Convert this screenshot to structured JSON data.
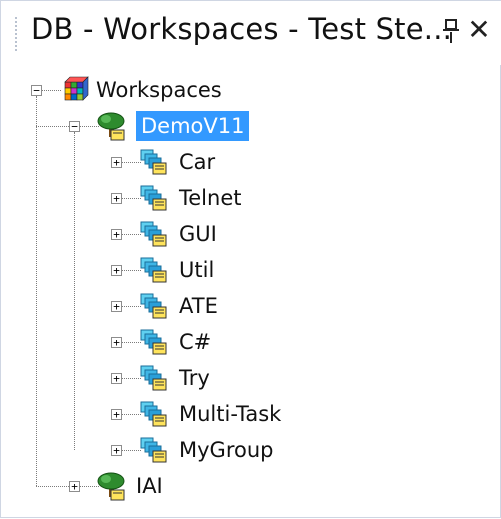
{
  "window": {
    "title": "DB - Workspaces - Test Ste...",
    "pin_icon": "pin-icon",
    "close_icon": "close-icon"
  },
  "tree": {
    "root": {
      "label": "Workspaces",
      "icon": "workspaces-cube-icon",
      "expanded": true
    },
    "workspaces": [
      {
        "label": "DemoV11",
        "icon": "tree-folder-icon",
        "expanded": true,
        "selected": true,
        "children": [
          {
            "label": "Car",
            "icon": "group-icon"
          },
          {
            "label": "Telnet",
            "icon": "group-icon"
          },
          {
            "label": "GUI",
            "icon": "group-icon"
          },
          {
            "label": "Util",
            "icon": "group-icon"
          },
          {
            "label": "ATE",
            "icon": "group-icon"
          },
          {
            "label": "C#",
            "icon": "group-icon"
          },
          {
            "label": "Try",
            "icon": "group-icon"
          },
          {
            "label": "Multi-Task",
            "icon": "group-icon"
          },
          {
            "label": "MyGroup",
            "icon": "group-icon"
          }
        ]
      },
      {
        "label": "IAI",
        "icon": "tree-folder-icon",
        "expanded": false,
        "selected": false
      }
    ]
  },
  "expander_symbols": {
    "collapsed": "+",
    "expanded": "−"
  },
  "colors": {
    "selection": "#3399ff",
    "tree_lines": "#7b7b7b"
  }
}
